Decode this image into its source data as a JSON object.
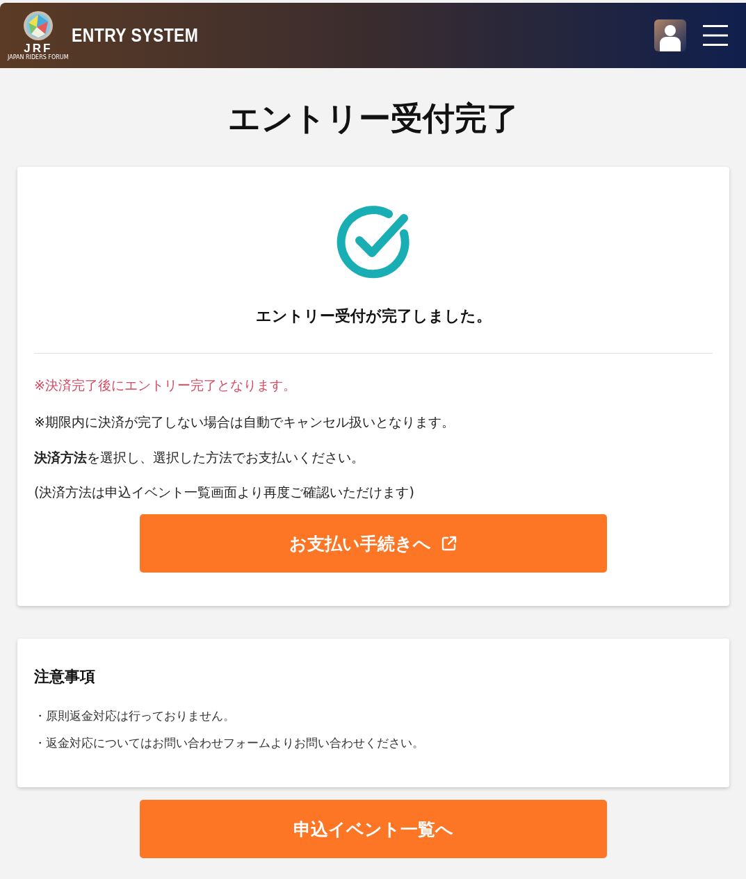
{
  "header": {
    "logo_text": "JRF",
    "logo_subtext": "JAPAN RIDERS FORUM",
    "title": "ENTRY SYSTEM"
  },
  "page_title": "エントリー受付完了",
  "completion_card": {
    "message": "エントリー受付が完了しました。",
    "notes": [
      {
        "kind": "warning",
        "text": "※決済完了後にエントリー完了となります。"
      },
      {
        "kind": "normal",
        "text": "※期限内に決済が完了しない場合は自動でキャンセル扱いとなります。"
      },
      {
        "kind": "normal",
        "text": "**決済方法**を選択し、選択した方法でお支払いください。"
      },
      {
        "kind": "normal",
        "text": "(決済方法は申込イベント一覧画面より再度ご確認いただけます)"
      }
    ],
    "button": "お支払い手続きへ"
  },
  "notice_card": {
    "title": "注意事項",
    "items": [
      "・原則返金対応は行っておりません。",
      "・返金対応についてはお問い合わせフォームよりお問い合わせください。"
    ]
  },
  "bottom_button": "申込イベント一覧へ"
}
